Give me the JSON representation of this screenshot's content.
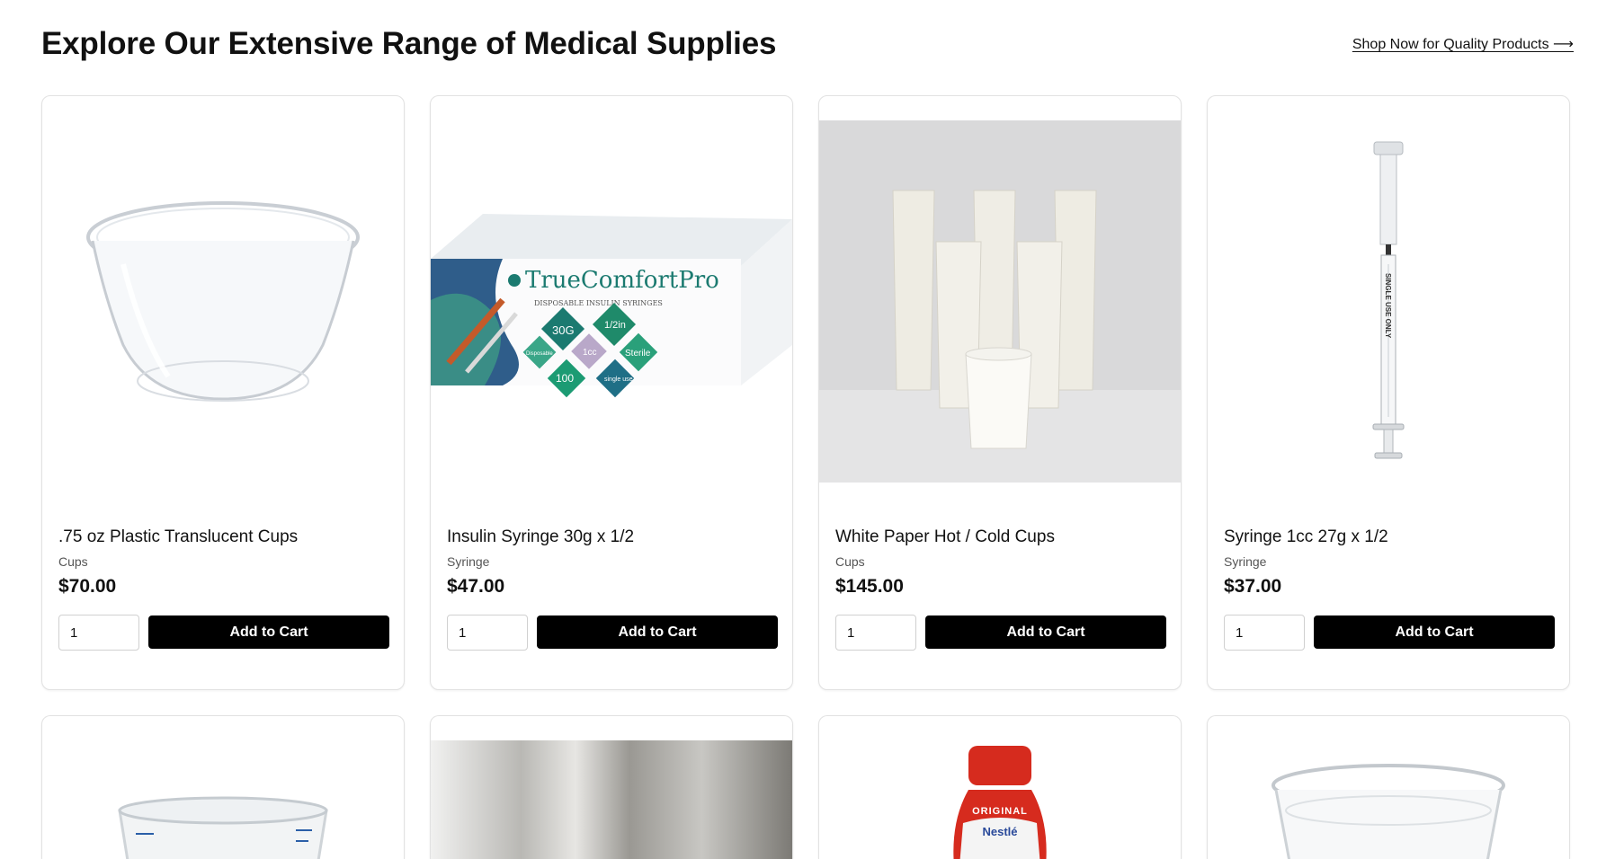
{
  "header": {
    "title": "Explore Our Extensive Range of Medical Supplies",
    "shop_link": "Shop Now for Quality Products ⟶"
  },
  "products": [
    {
      "name": ".75 oz Plastic Translucent Cups",
      "category": "Cups",
      "price": "$70.00",
      "quantity": "1",
      "button": "Add to Cart",
      "image_icon": "plastic-cup-image"
    },
    {
      "name": "Insulin Syringe 30g x 1/2",
      "category": "Syringe",
      "price": "$47.00",
      "quantity": "1",
      "button": "Add to Cart",
      "image_icon": "insulin-syringe-box-image",
      "image_text": {
        "brand": "TrueComfortPro",
        "sub": "DISPOSABLE INSULIN SYRINGES",
        "gauge": "30G",
        "length": "1/2in",
        "volume": "1cc",
        "sterile": "Sterile",
        "count": "100",
        "disposable": "Disposable",
        "single_use": "single use"
      }
    },
    {
      "name": "White Paper Hot / Cold Cups",
      "category": "Cups",
      "price": "$145.00",
      "quantity": "1",
      "button": "Add to Cart",
      "image_icon": "paper-cups-image"
    },
    {
      "name": "Syringe 1cc 27g x 1/2",
      "category": "Syringe",
      "price": "$37.00",
      "quantity": "1",
      "button": "Add to Cart",
      "image_icon": "syringe-image",
      "image_text": {
        "barrel": "SINGLE USE ONLY"
      }
    }
  ],
  "partial_products": [
    {
      "image_icon": "graduated-cup-image"
    },
    {
      "image_icon": "blurred-photo-image"
    },
    {
      "image_icon": "nutrition-bottle-image",
      "image_text": {
        "label": "ORIGINAL",
        "brand": "Nestlé"
      }
    },
    {
      "image_icon": "clear-cup-image"
    }
  ],
  "colors": {
    "button_bg": "#000000",
    "button_text": "#ffffff",
    "accent_teal": "#1b7a70",
    "bottle_red": "#d62b1e"
  }
}
